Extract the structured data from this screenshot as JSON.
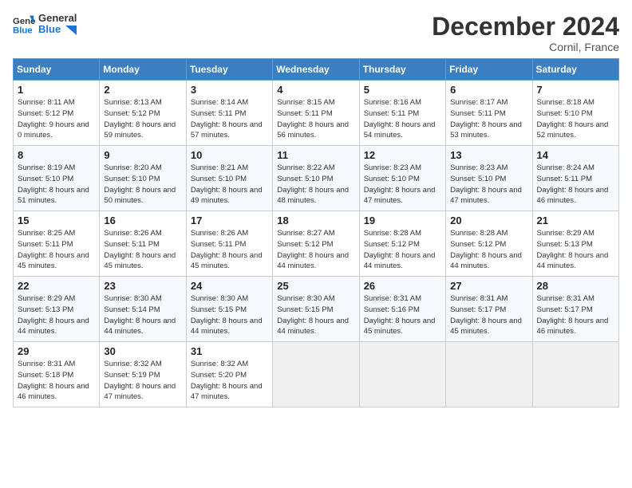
{
  "logo": {
    "line1": "General",
    "line2": "Blue"
  },
  "title": "December 2024",
  "subtitle": "Cornil, France",
  "days_header": [
    "Sunday",
    "Monday",
    "Tuesday",
    "Wednesday",
    "Thursday",
    "Friday",
    "Saturday"
  ],
  "weeks": [
    [
      {
        "day": "1",
        "sunrise": "Sunrise: 8:11 AM",
        "sunset": "Sunset: 5:12 PM",
        "daylight": "Daylight: 9 hours and 0 minutes."
      },
      {
        "day": "2",
        "sunrise": "Sunrise: 8:13 AM",
        "sunset": "Sunset: 5:12 PM",
        "daylight": "Daylight: 8 hours and 59 minutes."
      },
      {
        "day": "3",
        "sunrise": "Sunrise: 8:14 AM",
        "sunset": "Sunset: 5:11 PM",
        "daylight": "Daylight: 8 hours and 57 minutes."
      },
      {
        "day": "4",
        "sunrise": "Sunrise: 8:15 AM",
        "sunset": "Sunset: 5:11 PM",
        "daylight": "Daylight: 8 hours and 56 minutes."
      },
      {
        "day": "5",
        "sunrise": "Sunrise: 8:16 AM",
        "sunset": "Sunset: 5:11 PM",
        "daylight": "Daylight: 8 hours and 54 minutes."
      },
      {
        "day": "6",
        "sunrise": "Sunrise: 8:17 AM",
        "sunset": "Sunset: 5:11 PM",
        "daylight": "Daylight: 8 hours and 53 minutes."
      },
      {
        "day": "7",
        "sunrise": "Sunrise: 8:18 AM",
        "sunset": "Sunset: 5:10 PM",
        "daylight": "Daylight: 8 hours and 52 minutes."
      }
    ],
    [
      {
        "day": "8",
        "sunrise": "Sunrise: 8:19 AM",
        "sunset": "Sunset: 5:10 PM",
        "daylight": "Daylight: 8 hours and 51 minutes."
      },
      {
        "day": "9",
        "sunrise": "Sunrise: 8:20 AM",
        "sunset": "Sunset: 5:10 PM",
        "daylight": "Daylight: 8 hours and 50 minutes."
      },
      {
        "day": "10",
        "sunrise": "Sunrise: 8:21 AM",
        "sunset": "Sunset: 5:10 PM",
        "daylight": "Daylight: 8 hours and 49 minutes."
      },
      {
        "day": "11",
        "sunrise": "Sunrise: 8:22 AM",
        "sunset": "Sunset: 5:10 PM",
        "daylight": "Daylight: 8 hours and 48 minutes."
      },
      {
        "day": "12",
        "sunrise": "Sunrise: 8:23 AM",
        "sunset": "Sunset: 5:10 PM",
        "daylight": "Daylight: 8 hours and 47 minutes."
      },
      {
        "day": "13",
        "sunrise": "Sunrise: 8:23 AM",
        "sunset": "Sunset: 5:10 PM",
        "daylight": "Daylight: 8 hours and 47 minutes."
      },
      {
        "day": "14",
        "sunrise": "Sunrise: 8:24 AM",
        "sunset": "Sunset: 5:11 PM",
        "daylight": "Daylight: 8 hours and 46 minutes."
      }
    ],
    [
      {
        "day": "15",
        "sunrise": "Sunrise: 8:25 AM",
        "sunset": "Sunset: 5:11 PM",
        "daylight": "Daylight: 8 hours and 45 minutes."
      },
      {
        "day": "16",
        "sunrise": "Sunrise: 8:26 AM",
        "sunset": "Sunset: 5:11 PM",
        "daylight": "Daylight: 8 hours and 45 minutes."
      },
      {
        "day": "17",
        "sunrise": "Sunrise: 8:26 AM",
        "sunset": "Sunset: 5:11 PM",
        "daylight": "Daylight: 8 hours and 45 minutes."
      },
      {
        "day": "18",
        "sunrise": "Sunrise: 8:27 AM",
        "sunset": "Sunset: 5:12 PM",
        "daylight": "Daylight: 8 hours and 44 minutes."
      },
      {
        "day": "19",
        "sunrise": "Sunrise: 8:28 AM",
        "sunset": "Sunset: 5:12 PM",
        "daylight": "Daylight: 8 hours and 44 minutes."
      },
      {
        "day": "20",
        "sunrise": "Sunrise: 8:28 AM",
        "sunset": "Sunset: 5:12 PM",
        "daylight": "Daylight: 8 hours and 44 minutes."
      },
      {
        "day": "21",
        "sunrise": "Sunrise: 8:29 AM",
        "sunset": "Sunset: 5:13 PM",
        "daylight": "Daylight: 8 hours and 44 minutes."
      }
    ],
    [
      {
        "day": "22",
        "sunrise": "Sunrise: 8:29 AM",
        "sunset": "Sunset: 5:13 PM",
        "daylight": "Daylight: 8 hours and 44 minutes."
      },
      {
        "day": "23",
        "sunrise": "Sunrise: 8:30 AM",
        "sunset": "Sunset: 5:14 PM",
        "daylight": "Daylight: 8 hours and 44 minutes."
      },
      {
        "day": "24",
        "sunrise": "Sunrise: 8:30 AM",
        "sunset": "Sunset: 5:15 PM",
        "daylight": "Daylight: 8 hours and 44 minutes."
      },
      {
        "day": "25",
        "sunrise": "Sunrise: 8:30 AM",
        "sunset": "Sunset: 5:15 PM",
        "daylight": "Daylight: 8 hours and 44 minutes."
      },
      {
        "day": "26",
        "sunrise": "Sunrise: 8:31 AM",
        "sunset": "Sunset: 5:16 PM",
        "daylight": "Daylight: 8 hours and 45 minutes."
      },
      {
        "day": "27",
        "sunrise": "Sunrise: 8:31 AM",
        "sunset": "Sunset: 5:17 PM",
        "daylight": "Daylight: 8 hours and 45 minutes."
      },
      {
        "day": "28",
        "sunrise": "Sunrise: 8:31 AM",
        "sunset": "Sunset: 5:17 PM",
        "daylight": "Daylight: 8 hours and 46 minutes."
      }
    ],
    [
      {
        "day": "29",
        "sunrise": "Sunrise: 8:31 AM",
        "sunset": "Sunset: 5:18 PM",
        "daylight": "Daylight: 8 hours and 46 minutes."
      },
      {
        "day": "30",
        "sunrise": "Sunrise: 8:32 AM",
        "sunset": "Sunset: 5:19 PM",
        "daylight": "Daylight: 8 hours and 47 minutes."
      },
      {
        "day": "31",
        "sunrise": "Sunrise: 8:32 AM",
        "sunset": "Sunset: 5:20 PM",
        "daylight": "Daylight: 8 hours and 47 minutes."
      },
      null,
      null,
      null,
      null
    ]
  ]
}
